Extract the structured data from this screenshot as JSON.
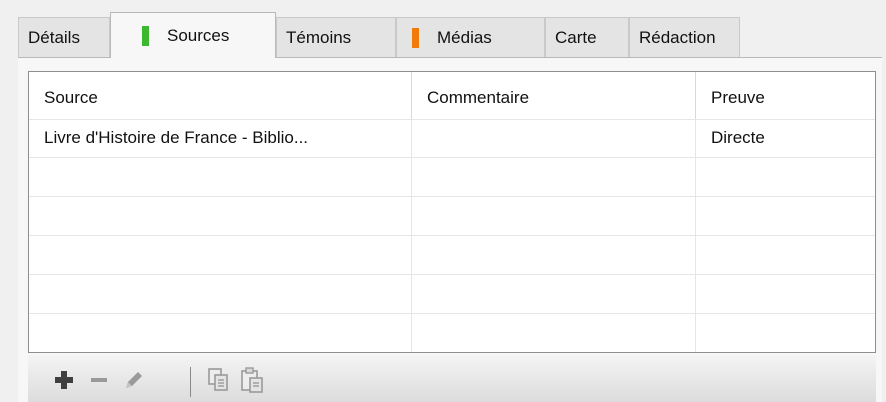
{
  "tabs": [
    {
      "label": "Détails",
      "active": false
    },
    {
      "label": "Sources",
      "active": true,
      "marker_color": "#3cb82e"
    },
    {
      "label": "Témoins",
      "active": false
    },
    {
      "label": "Médias",
      "active": false,
      "marker_color": "#f07a0a"
    },
    {
      "label": "Carte",
      "active": false
    },
    {
      "label": "Rédaction",
      "active": false
    }
  ],
  "table": {
    "columns": [
      "Source",
      "Commentaire",
      "Preuve"
    ],
    "rows": [
      [
        "Livre d'Histoire de France - Biblio...",
        "",
        "Directe"
      ],
      [
        "",
        "",
        ""
      ],
      [
        "",
        "",
        ""
      ],
      [
        "",
        "",
        ""
      ],
      [
        "",
        "",
        ""
      ],
      [
        "",
        "",
        ""
      ]
    ]
  },
  "toolbar": {
    "buttons": [
      {
        "icon": "plus-icon",
        "enabled": true
      },
      {
        "icon": "minus-icon",
        "enabled": false
      },
      {
        "icon": "pencil-icon",
        "enabled": false
      },
      {
        "icon": "copy-icon",
        "enabled": false
      },
      {
        "icon": "paste-icon",
        "enabled": false
      }
    ]
  },
  "colors": {
    "marker_sources": "#3cb82e",
    "marker_medias": "#f07a0a",
    "disabled_icon": "#9a9a9a"
  }
}
